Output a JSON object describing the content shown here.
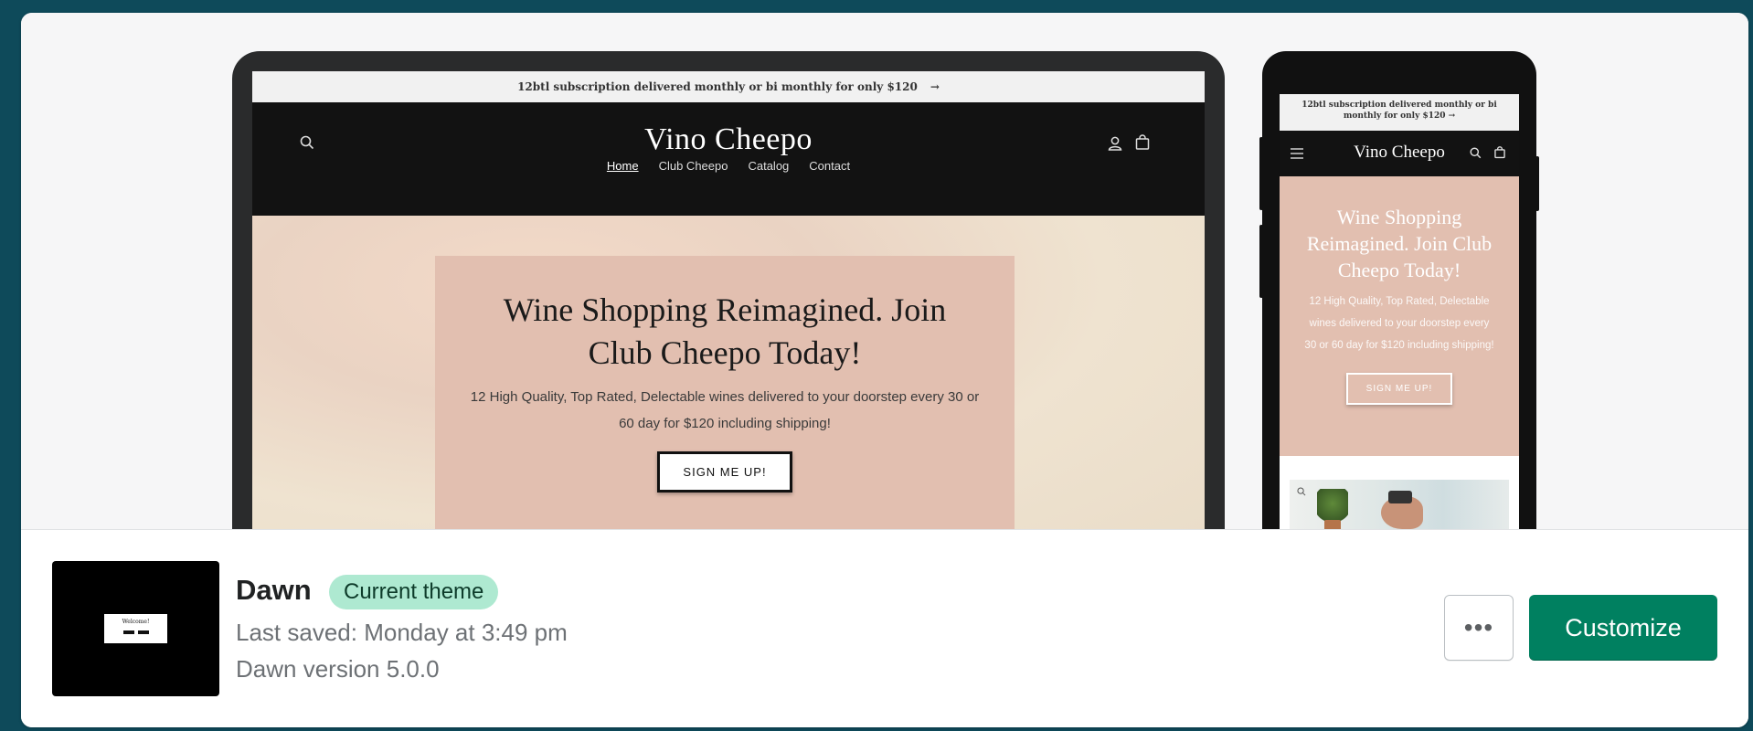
{
  "desktop_preview": {
    "announcement": "12btl subscription delivered monthly or bi monthly for only $120",
    "store_name": "Vino Cheepo",
    "nav": [
      "Home",
      "Club Cheepo",
      "Catalog",
      "Contact"
    ],
    "hero_title": "Wine Shopping Reimagined. Join Club Cheepo Today!",
    "hero_sub": "12 High Quality, Top Rated, Delectable wines delivered to your doorstep every 30 or 60 day for $120 including shipping!",
    "hero_button": "SIGN ME UP!"
  },
  "mobile_preview": {
    "announcement": "12btl subscription delivered monthly or bi monthly for only $120",
    "store_name": "Vino Cheepo",
    "hero_title": "Wine Shopping Reimagined. Join Club Cheepo Today!",
    "hero_sub": "12 High Quality, Top Rated, Delectable wines delivered to your doorstep every 30 or 60 day for $120 including shipping!",
    "hero_button": "SIGN ME UP!"
  },
  "theme": {
    "name": "Dawn",
    "badge": "Current theme",
    "last_saved": "Last saved: Monday at 3:49 pm",
    "version": "Dawn version 5.0.0",
    "thumbnail_text": "Welcome!"
  },
  "actions": {
    "more_label": "•••",
    "customize_label": "Customize"
  },
  "colors": {
    "page_bg": "#0e4a5a",
    "primary": "#008060",
    "badge_bg": "#aee9d1",
    "hero_box": "#e2bfb0"
  }
}
